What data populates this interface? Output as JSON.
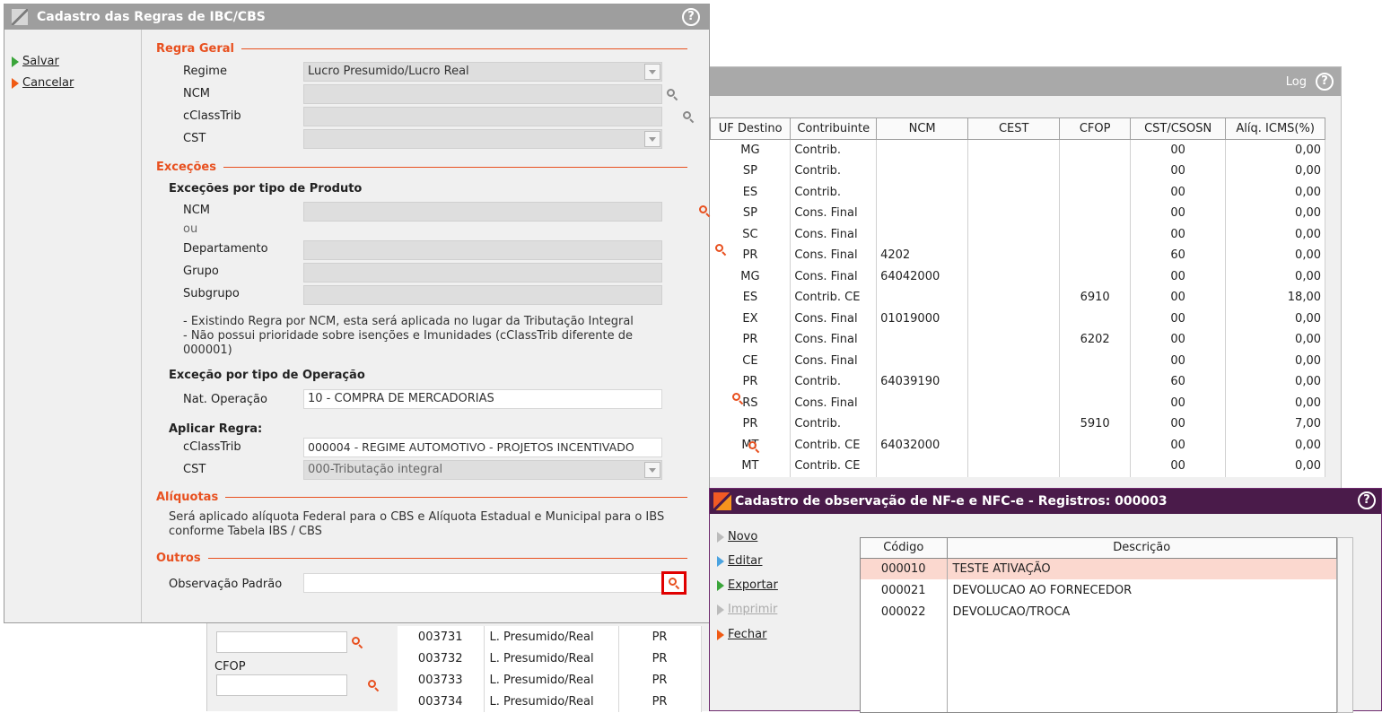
{
  "back_window": {
    "title_right": "Log",
    "columns": [
      "UF Destino",
      "Contribuinte",
      "NCM",
      "CEST",
      "CFOP",
      "CST/CSOSN",
      "Alíq. ICMS(%)"
    ],
    "rows": [
      [
        "MG",
        "Contrib.",
        "",
        "",
        "",
        "00",
        "0,00"
      ],
      [
        "SP",
        "Contrib.",
        "",
        "",
        "",
        "00",
        "0,00"
      ],
      [
        "ES",
        "Contrib.",
        "",
        "",
        "",
        "00",
        "0,00"
      ],
      [
        "SP",
        "Cons. Final",
        "",
        "",
        "",
        "00",
        "0,00"
      ],
      [
        "SC",
        "Cons. Final",
        "",
        "",
        "",
        "00",
        "0,00"
      ],
      [
        "PR",
        "Cons. Final",
        "4202",
        "",
        "",
        "60",
        "0,00"
      ],
      [
        "MG",
        "Cons. Final",
        "64042000",
        "",
        "",
        "00",
        "0,00"
      ],
      [
        "ES",
        "Contrib. CE",
        "",
        "",
        "6910",
        "00",
        "18,00"
      ],
      [
        "EX",
        "Cons. Final",
        "01019000",
        "",
        "",
        "00",
        "0,00"
      ],
      [
        "PR",
        "Cons. Final",
        "",
        "",
        "6202",
        "00",
        "0,00"
      ],
      [
        "CE",
        "Cons. Final",
        "",
        "",
        "",
        "00",
        "0,00"
      ],
      [
        "PR",
        "Contrib.",
        "64039190",
        "",
        "",
        "60",
        "0,00"
      ],
      [
        "RS",
        "Cons. Final",
        "",
        "",
        "",
        "00",
        "0,00"
      ],
      [
        "PR",
        "Contrib.",
        "",
        "",
        "5910",
        "00",
        "7,00"
      ],
      [
        "MT",
        "Contrib. CE",
        "64032000",
        "",
        "",
        "00",
        "0,00"
      ],
      [
        "MT",
        "Contrib. CE",
        "",
        "",
        "",
        "00",
        "0,00"
      ]
    ]
  },
  "consulta_window": {
    "label_cfop": "CFOP",
    "rows": [
      [
        "003731",
        "L. Presumido/Real",
        "PR"
      ],
      [
        "003732",
        "L. Presumido/Real",
        "PR"
      ],
      [
        "003733",
        "L. Presumido/Real",
        "PR"
      ],
      [
        "003734",
        "L. Presumido/Real",
        "PR"
      ]
    ]
  },
  "main_window": {
    "title": "Cadastro das Regras de IBC/CBS",
    "side": {
      "salvar": "Salvar",
      "cancelar": "Cancelar"
    },
    "regra_geral": {
      "section": "Regra Geral",
      "regime_label": "Regime",
      "regime_value": "Lucro Presumido/Lucro Real",
      "ncm_label": "NCM",
      "cclasstrib_label": "cClassTrib",
      "cst_label": "CST"
    },
    "excecoes": {
      "section": "Exceções",
      "produto_title": "Exceções por tipo de Produto",
      "ncm_label": "NCM",
      "ou_label": "ou",
      "departamento_label": "Departamento",
      "grupo_label": "Grupo",
      "subgrupo_label": "Subgrupo",
      "note1": "- Existindo Regra por NCM, esta será aplicada no lugar da Tributação Integral",
      "note2": "- Não possui prioridade sobre isenções e Imunidades (cClassTrib diferente de 000001)",
      "operacao_title": "Exceção por tipo de Operação",
      "nat_operacao_label": "Nat. Operação",
      "nat_operacao_value": "10 - COMPRA DE MERCADORIAS",
      "aplicar_title": "Aplicar Regra:",
      "aplicar_cclasstrib_label": "cClassTrib",
      "aplicar_cclasstrib_value": "000004 - REGIME AUTOMOTIVO - PROJETOS INCENTIVADO",
      "aplicar_cst_label": "CST",
      "aplicar_cst_value": "000-Tributação integral"
    },
    "aliquotas": {
      "section": "Alíquotas",
      "text": "Será aplicado alíquota Federal para o CBS e Alíquota Estadual e Municipal para o IBS conforme Tabela IBS / CBS"
    },
    "outros": {
      "section": "Outros",
      "obs_label": "Observação Padrão",
      "obs_value": ""
    }
  },
  "obs_window": {
    "title": "Cadastro de observação de NF-e e NFC-e - Registros: 000003",
    "side": {
      "novo": "Novo",
      "editar": "Editar",
      "exportar": "Exportar",
      "imprimir": "Imprimir",
      "fechar": "Fechar"
    },
    "columns": [
      "Código",
      "Descrição"
    ],
    "rows": [
      [
        "000010",
        "TESTE ATIVAÇÃO"
      ],
      [
        "000021",
        "DEVOLUCAO AO FORNECEDOR"
      ],
      [
        "000022",
        "DEVOLUCAO/TROCA"
      ]
    ],
    "selected_row": 0
  },
  "colors": {
    "accent": "#e8501f",
    "obs_title": "#4a1b4a",
    "selected_row": "#fbd8cf",
    "highlight_box": "#e00000"
  }
}
